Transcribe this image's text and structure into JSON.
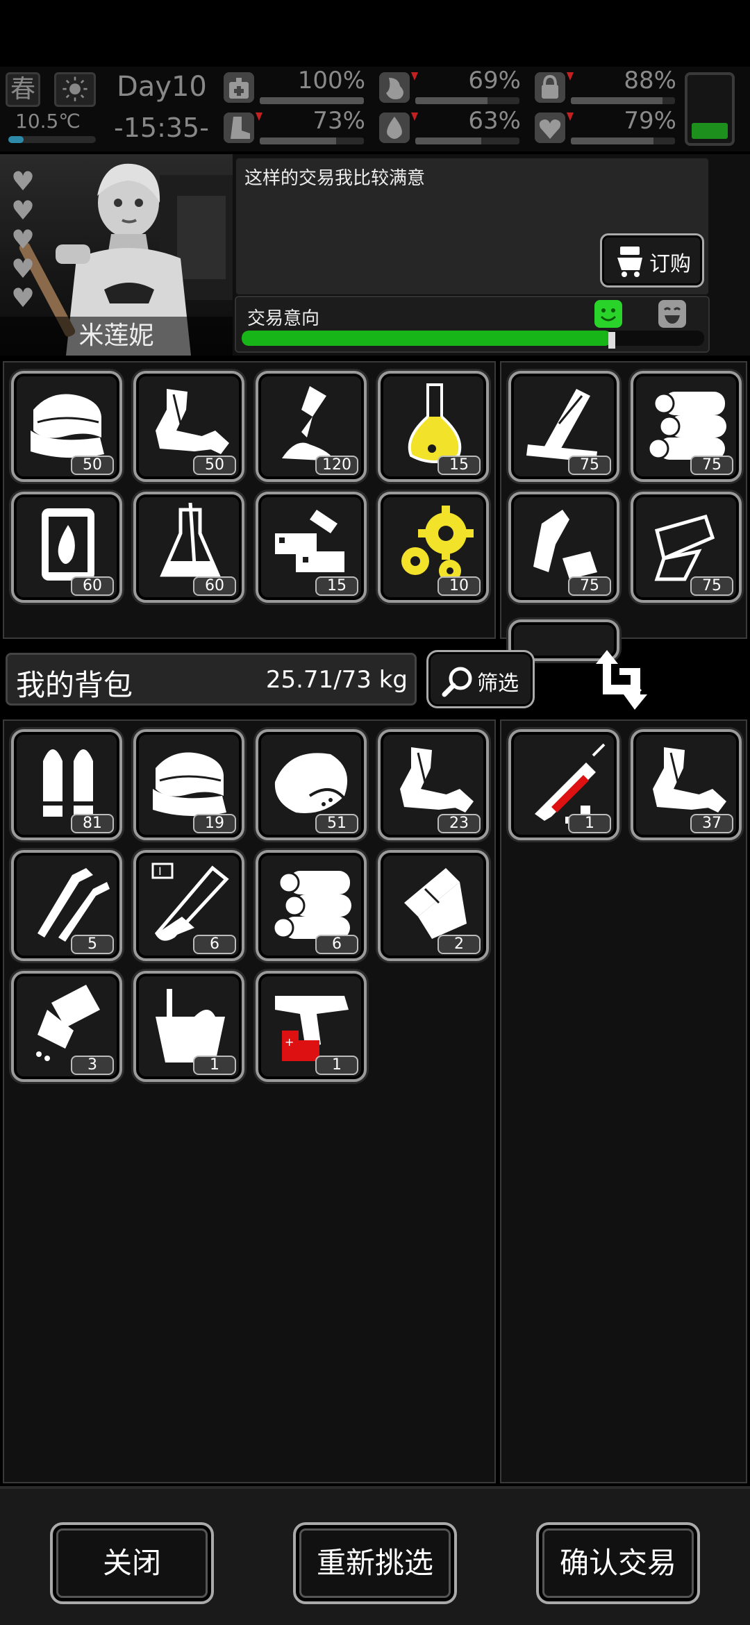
{
  "status": {
    "season": "春",
    "temperature": "10.5℃",
    "day": "Day10",
    "time": "-15:35-",
    "stats": [
      {
        "icon": "medkit-icon",
        "value": "100%",
        "level": 100,
        "declining": false
      },
      {
        "icon": "stomach-icon",
        "value": "69%",
        "level": 69,
        "declining": true
      },
      {
        "icon": "lock-icon",
        "value": "88%",
        "level": 88,
        "declining": true
      },
      {
        "icon": "boot-icon",
        "value": "73%",
        "level": 73,
        "declining": true
      },
      {
        "icon": "water-drop-icon",
        "value": "63%",
        "level": 63,
        "declining": true
      },
      {
        "icon": "heart-icon",
        "value": "79%",
        "level": 79,
        "declining": true
      }
    ],
    "battery_level": 0.25
  },
  "npc": {
    "name": "米莲妮",
    "affinity_hearts": 5,
    "speech": "这样的交易我比较满意",
    "order_label": "订购",
    "intent_label": "交易意向",
    "intent_level": 0.8
  },
  "trader_items_left": [
    {
      "icon": "cloth-icon",
      "count": "50"
    },
    {
      "icon": "rags-icon",
      "count": "50"
    },
    {
      "icon": "glue-tube-icon",
      "count": "120"
    },
    {
      "icon": "yellow-flask-icon",
      "count": "15"
    },
    {
      "icon": "fuel-barrel-icon",
      "count": "60"
    },
    {
      "icon": "beaker-icon",
      "count": "60"
    },
    {
      "icon": "electronics-icon",
      "count": "15"
    },
    {
      "icon": "gears-icon",
      "count": "10"
    }
  ],
  "trader_items_right": [
    {
      "icon": "planks-icon",
      "count": "75"
    },
    {
      "icon": "logs-icon",
      "count": "75"
    },
    {
      "icon": "plastic-bottles-icon",
      "count": "75"
    },
    {
      "icon": "glass-shards-icon",
      "count": "75"
    }
  ],
  "backpack": {
    "title": "我的背包",
    "weight": "25.71/73 kg",
    "filter_label": "筛选"
  },
  "backpack_items": [
    {
      "icon": "bullets-icon",
      "count": "81"
    },
    {
      "icon": "cloth-icon",
      "count": "19"
    },
    {
      "icon": "meat-icon",
      "count": "51"
    },
    {
      "icon": "rags-icon",
      "count": "23"
    },
    {
      "icon": "screws-icon",
      "count": "5"
    },
    {
      "icon": "test-tube-icon",
      "count": "6"
    },
    {
      "icon": "logs-icon",
      "count": "6"
    },
    {
      "icon": "paper-rolls-icon",
      "count": "2"
    },
    {
      "icon": "pills-bottle-icon",
      "count": "3"
    },
    {
      "icon": "bucket-icon",
      "count": "1"
    },
    {
      "icon": "flare-gun-icon",
      "count": "1"
    }
  ],
  "offer_items": [
    {
      "icon": "syringe-icon",
      "count": "1"
    },
    {
      "icon": "rags-icon",
      "count": "37"
    }
  ],
  "actions": {
    "close": "关闭",
    "reselect": "重新挑选",
    "confirm": "确认交易"
  }
}
